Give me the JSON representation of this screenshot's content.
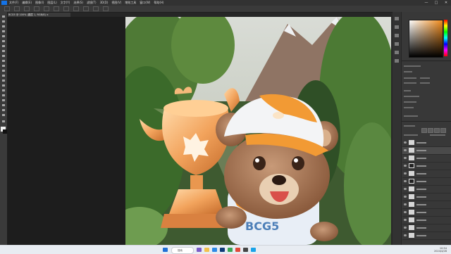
{
  "app": {
    "logo": "Ps"
  },
  "menu": [
    "文件(F)",
    "编辑(E)",
    "图像(I)",
    "图层(L)",
    "文字(Y)",
    "选择(S)",
    "滤镜(T)",
    "3D(D)",
    "视图(V)",
    "增效工具",
    "窗口(W)",
    "帮助(H)"
  ],
  "window_controls": {
    "minimize": "—",
    "maximize": "□",
    "close": "✕"
  },
  "document_tab": {
    "label": "BCG5 @ 100% (图层 1, RGB/8) ×"
  },
  "artwork": {
    "shirt_text": "BCG5"
  },
  "taskbar": {
    "search_label": "搜索",
    "time": "10:54",
    "date": "2024/4/28"
  },
  "colors": {
    "accent": "#1473e6",
    "foreground_swatch": "#f08a1a"
  }
}
